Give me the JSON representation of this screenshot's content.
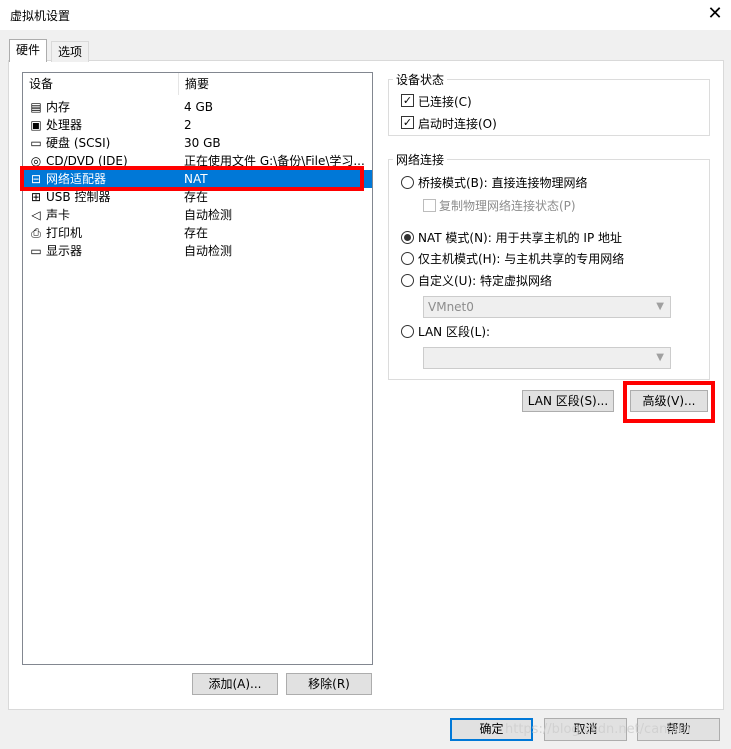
{
  "window": {
    "title": "虚拟机设置",
    "close_glyph": "✕"
  },
  "tabs": [
    {
      "label": "硬件"
    },
    {
      "label": "选项"
    }
  ],
  "device_list": {
    "headers": {
      "device": "设备",
      "summary": "摘要"
    },
    "rows": [
      {
        "icon": "memory-icon",
        "glyph": "▤",
        "name": "内存",
        "summary": "4 GB"
      },
      {
        "icon": "processor-icon",
        "glyph": "▣",
        "name": "处理器",
        "summary": "2"
      },
      {
        "icon": "harddisk-icon",
        "glyph": "▭",
        "name": "硬盘 (SCSI)",
        "summary": "30 GB"
      },
      {
        "icon": "cdrom-icon",
        "glyph": "◎",
        "name": "CD/DVD (IDE)",
        "summary": "正在使用文件 G:\\备份\\File\\学习..."
      },
      {
        "icon": "network-icon",
        "glyph": "⊟",
        "name": "网络适配器",
        "summary": "NAT"
      },
      {
        "icon": "usb-icon",
        "glyph": "⊞",
        "name": "USB 控制器",
        "summary": "存在"
      },
      {
        "icon": "sound-icon",
        "glyph": "◁",
        "name": "声卡",
        "summary": "自动检测"
      },
      {
        "icon": "printer-icon",
        "glyph": "⎙",
        "name": "打印机",
        "summary": "存在"
      },
      {
        "icon": "display-icon",
        "glyph": "▭",
        "name": "显示器",
        "summary": "自动检测"
      }
    ],
    "selected_index": 4
  },
  "buttons": {
    "add": "添加(A)...",
    "remove": "移除(R)",
    "lan_segments": "LAN 区段(S)...",
    "advanced": "高级(V)...",
    "ok": "确定",
    "cancel": "取消",
    "help": "帮助"
  },
  "device_status": {
    "title": "设备状态",
    "connected": {
      "label": "已连接(C)",
      "checked": true
    },
    "connect_at_power_on": {
      "label": "启动时连接(O)",
      "checked": true
    }
  },
  "network_connection": {
    "title": "网络连接",
    "bridged": "桥接模式(B): 直接连接物理网络",
    "replicate": "复制物理网络连接状态(P)",
    "nat": "NAT 模式(N): 用于共享主机的 IP 地址",
    "host_only": "仅主机模式(H): 与主机共享的专用网络",
    "custom": "自定义(U): 特定虚拟网络",
    "custom_value": "VMnet0",
    "lan_segment": "LAN 区段(L):",
    "lan_segment_value": "",
    "selected": "nat"
  },
  "watermark": "https://blog.csdn.net/cansun",
  "colors": {
    "selection": "#0078d7",
    "highlight": "#ff0000"
  }
}
